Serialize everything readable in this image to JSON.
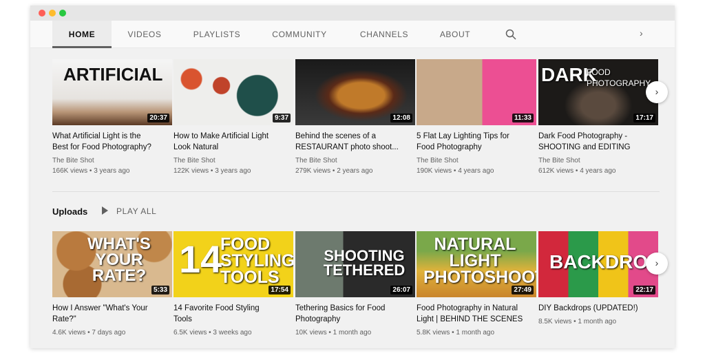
{
  "nav": {
    "tabs": [
      "HOME",
      "VIDEOS",
      "PLAYLISTS",
      "COMMUNITY",
      "CHANNELS",
      "ABOUT"
    ],
    "active": "HOME"
  },
  "featured": [
    {
      "title1": "What Artificial Light is the",
      "title2": "Best for Food Photography?",
      "channel": "The Bite Shot",
      "meta": "166K views • 3 years ago",
      "duration": "20:37",
      "overlay": "ARTIFICIAL"
    },
    {
      "title1": "How to Make Artificial Light",
      "title2": "Look Natural",
      "channel": "The Bite Shot",
      "meta": "122K views • 3 years ago",
      "duration": "9:37"
    },
    {
      "title1": "Behind the scenes of a",
      "title2": "RESTAURANT photo shoot...",
      "channel": "The Bite Shot",
      "meta": "279K views • 2 years ago",
      "duration": "12:08"
    },
    {
      "title1": "5 Flat Lay Lighting Tips for",
      "title2": "Food Photography",
      "channel": "The Bite Shot",
      "meta": "190K views • 4 years ago",
      "duration": "11:33"
    },
    {
      "title1": "Dark Food Photography -",
      "title2": "SHOOTING and EDITING",
      "channel": "The Bite Shot",
      "meta": "612K views • 4 years ago",
      "duration": "17:17",
      "overlay": "DARK",
      "overlay2": "FOOD PHOTOGRAPHY"
    }
  ],
  "uploads": {
    "label": "Uploads",
    "play_all": "PLAY ALL",
    "items": [
      {
        "title1": "How I Answer \"What's Your",
        "title2": "Rate?\"",
        "meta": "4.6K views • 7 days ago",
        "duration": "5:33",
        "overlay": "WHAT'S YOUR RATE?"
      },
      {
        "title1": "14 Favorite Food Styling",
        "title2": "Tools",
        "meta": "6.5K views • 3 weeks ago",
        "duration": "17:54",
        "overlay": "14",
        "overlay2": "FOOD STYLING TOOLS"
      },
      {
        "title1": "Tethering Basics for Food",
        "title2": "Photography",
        "meta": "10K views • 1 month ago",
        "duration": "26:07",
        "overlay": "SHOOTING TETHERED"
      },
      {
        "title1": "Food Photography in Natural",
        "title2": "Light | BEHIND THE SCENES",
        "meta": "5.8K views • 1 month ago",
        "duration": "27:49",
        "overlay": "NATURAL LIGHT PHOTOSHOOT"
      },
      {
        "title1": "DIY Backdrops (UPDATED!)",
        "title2": "",
        "meta": "8.5K views • 1 month ago",
        "duration": "22:17",
        "overlay": "BACKDROPS"
      }
    ]
  },
  "colors": {
    "bg": "#f1f1f1",
    "text": "#0f0f0f",
    "muted": "#606060"
  }
}
